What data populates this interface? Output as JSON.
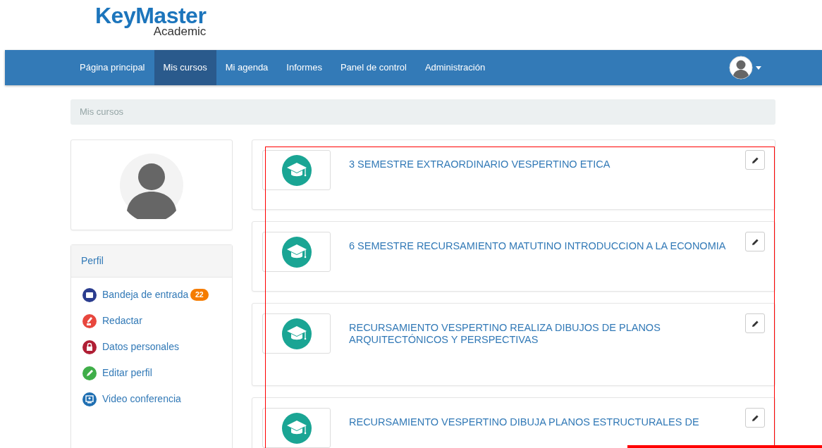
{
  "logo": {
    "name": "KeyMaster",
    "subtitle": "Academic"
  },
  "nav": {
    "items": [
      {
        "label": "Página principal",
        "selected": false
      },
      {
        "label": "Mis cursos",
        "selected": true
      },
      {
        "label": "Mi agenda",
        "selected": false
      },
      {
        "label": "Informes",
        "selected": false
      },
      {
        "label": "Panel de control",
        "selected": false
      },
      {
        "label": "Administración",
        "selected": false
      }
    ]
  },
  "breadcrumb": "Mis cursos",
  "profile_menu": {
    "title": "Perfil",
    "items": [
      {
        "kind": "inbox",
        "label": "Bandeja de entrada",
        "badge": "22",
        "color": "#2b3d8f"
      },
      {
        "kind": "compose",
        "label": "Redactar",
        "color": "#e8473e"
      },
      {
        "kind": "lock",
        "label": "Datos personales",
        "color": "#b01f35"
      },
      {
        "kind": "edit",
        "label": "Editar perfil",
        "color": "#3fae49"
      },
      {
        "kind": "video",
        "label": "Video conferencia",
        "color": "#1f6fb2"
      }
    ]
  },
  "courses": [
    {
      "title": "3 SEMESTRE EXTRAORDINARIO VESPERTINO ETICA"
    },
    {
      "title": "6 SEMESTRE RECURSAMIENTO MATUTINO INTRODUCCION A LA ECONOMIA"
    },
    {
      "title": "RECURSAMIENTO VESPERTINO REALIZA DIBUJOS DE PLANOS ARQUITECTÓNICOS Y PERSPECTIVAS"
    },
    {
      "title": "RECURSAMIENTO VESPERTINO DIBUJA PLANOS ESTRUCTURALES DE"
    }
  ]
}
